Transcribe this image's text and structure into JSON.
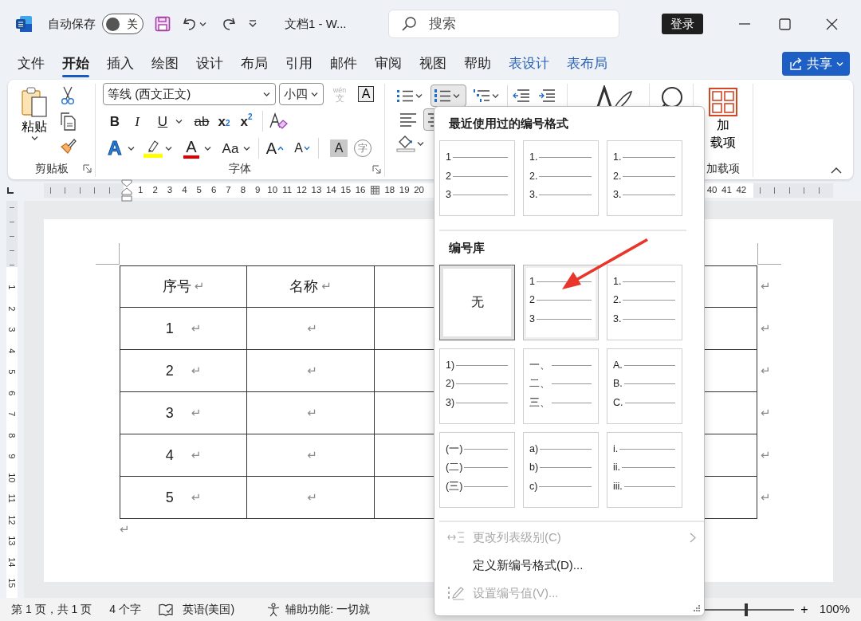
{
  "title_bar": {
    "autosave_label": "自动保存",
    "autosave": {
      "on": false,
      "label": "关"
    },
    "document_title": "文档1 - W...",
    "search": {
      "placeholder": "搜索"
    },
    "sign_in": "登录"
  },
  "tabs": [
    {
      "label": "文件",
      "selected": false,
      "kind": "normal"
    },
    {
      "label": "开始",
      "selected": true,
      "kind": "normal"
    },
    {
      "label": "插入",
      "selected": false,
      "kind": "normal"
    },
    {
      "label": "绘图",
      "selected": false,
      "kind": "normal"
    },
    {
      "label": "设计",
      "selected": false,
      "kind": "normal"
    },
    {
      "label": "布局",
      "selected": false,
      "kind": "normal"
    },
    {
      "label": "引用",
      "selected": false,
      "kind": "normal"
    },
    {
      "label": "邮件",
      "selected": false,
      "kind": "normal"
    },
    {
      "label": "审阅",
      "selected": false,
      "kind": "normal"
    },
    {
      "label": "视图",
      "selected": false,
      "kind": "normal"
    },
    {
      "label": "帮助",
      "selected": false,
      "kind": "normal"
    },
    {
      "label": "表设计",
      "selected": false,
      "kind": "contextual"
    },
    {
      "label": "表布局",
      "selected": false,
      "kind": "contextual"
    }
  ],
  "share_button": "共享",
  "ribbon": {
    "clipboard": {
      "paste": "粘贴",
      "label": "剪贴板"
    },
    "font": {
      "font_name": "等线 (西文正文)",
      "font_size": "小四",
      "phonetic": {
        "top": "wén",
        "bottom": "文",
        "disabled": true
      },
      "border_char": "A",
      "row2": [
        {
          "label": "B",
          "kind": "bold"
        },
        {
          "label": "I",
          "kind": "italic"
        },
        {
          "label": "U",
          "kind": "underline"
        },
        {
          "label": "ab",
          "kind": "strike"
        },
        {
          "label": "x$_{2}$",
          "kind": "subscript"
        },
        {
          "label": "x$^{2}$",
          "kind": "superscript"
        }
      ],
      "row3": [
        {
          "label": "A",
          "kind": "text_effect"
        },
        {
          "kind": "highlight"
        },
        {
          "label": "A",
          "kind": "font_color"
        },
        {
          "label": "Aa",
          "kind": "change_case"
        },
        {
          "label": "A",
          "kind": "grow"
        },
        {
          "label": "A",
          "kind": "shrink"
        },
        {
          "label": "A",
          "kind": "shade"
        },
        {
          "label": "字",
          "kind": "enclose"
        }
      ],
      "label": "字体"
    },
    "paragraph": {
      "numbering_expanded": true,
      "align": [
        {
          "kind": "left",
          "selected": false
        },
        {
          "kind": "center",
          "selected": true
        }
      ]
    },
    "add_ins": {
      "button_lines": [
        "加",
        "载项"
      ],
      "label": "加载项"
    }
  },
  "ruler": {
    "segments": [
      {
        "kind": "numbers",
        "numbers": [
          "1",
          "2",
          "3",
          "4",
          "5",
          "6",
          "7",
          "8",
          "9",
          "10",
          "11",
          "12",
          "13",
          "14",
          "15",
          "16"
        ]
      },
      {
        "kind": "marker"
      },
      {
        "kind": "numbers",
        "numbers": [
          "18",
          "19",
          "20"
        ]
      },
      {
        "kind": "spacer"
      },
      {
        "kind": "numbers",
        "numbers": [
          "40",
          "41",
          "42"
        ]
      }
    ]
  },
  "vertical_ruler": {
    "numbers": [
      "1",
      "2",
      "3",
      "4",
      "5",
      "6",
      "7",
      "8",
      "9",
      "10",
      "11",
      "12",
      "13",
      "14",
      "15"
    ]
  },
  "document": {
    "table": {
      "header": [
        {
          "text": "序号",
          "mark": "↵"
        },
        {
          "text": "名称",
          "mark": "↵"
        }
      ],
      "header_end_mark": "↵",
      "rows": [
        {
          "cells": [
            {
              "text": "1",
              "mark": "↵"
            },
            {
              "mark": "↵"
            }
          ],
          "end_mark": "↵"
        },
        {
          "cells": [
            {
              "text": "2",
              "mark": "↵"
            },
            {
              "mark": "↵"
            }
          ],
          "end_mark": "↵"
        },
        {
          "cells": [
            {
              "text": "3",
              "mark": "↵"
            },
            {
              "mark": "↵"
            }
          ],
          "end_mark": "↵"
        },
        {
          "cells": [
            {
              "text": "4",
              "mark": "↵"
            },
            {
              "mark": "↵"
            }
          ],
          "end_mark": "↵"
        },
        {
          "cells": [
            {
              "text": "5",
              "mark": "↵"
            },
            {
              "mark": "↵"
            }
          ],
          "end_mark": "↵"
        }
      ]
    },
    "end_mark": "↵"
  },
  "numbering_menu": {
    "recent_title": "最近使用过的编号格式",
    "recent": [
      {
        "kind": "list",
        "lines": [
          "1",
          "2",
          "3"
        ],
        "selected": false,
        "hovered": false
      },
      {
        "kind": "list",
        "lines": [
          "1.",
          "2.",
          "3."
        ],
        "selected": false,
        "hovered": false
      },
      {
        "kind": "list",
        "lines": [
          "1.",
          "2.",
          "3."
        ],
        "selected": false,
        "hovered": false
      }
    ],
    "library_title": "编号库",
    "library": [
      {
        "kind": "none",
        "label": "无",
        "selected": true,
        "hovered": false
      },
      {
        "kind": "list",
        "lines": [
          "1",
          "2",
          "3"
        ],
        "selected": false,
        "hovered": true
      },
      {
        "kind": "list",
        "lines": [
          "1.",
          "2.",
          "3."
        ],
        "selected": false,
        "hovered": false
      },
      {
        "kind": "list",
        "lines": [
          "1)",
          "2)",
          "3)"
        ],
        "selected": false,
        "hovered": false
      },
      {
        "kind": "list",
        "lines": [
          "一、",
          "二、",
          "三、"
        ],
        "selected": false,
        "hovered": false
      },
      {
        "kind": "list",
        "lines": [
          "A.",
          "B.",
          "C."
        ],
        "selected": false,
        "hovered": false
      },
      {
        "kind": "list",
        "lines": [
          "(一)",
          "(二)",
          "(三)"
        ],
        "selected": false,
        "hovered": false
      },
      {
        "kind": "list",
        "lines": [
          "a)",
          "b)",
          "c)"
        ],
        "selected": false,
        "hovered": false
      },
      {
        "kind": "list",
        "lines": [
          "i.",
          "ii.",
          "iii."
        ],
        "selected": false,
        "hovered": false
      }
    ],
    "items": [
      {
        "label": "更改列表级别(C)",
        "disabled": true,
        "kind": "level",
        "submenu": true
      },
      {
        "label": "定义新编号格式(D)...",
        "disabled": false,
        "kind": "plain",
        "submenu": false
      },
      {
        "label": "设置编号值(V)...",
        "disabled": true,
        "kind": "value",
        "submenu": false
      }
    ]
  },
  "status_bar": {
    "page": "第 1 页，共 1 页",
    "words": "4 个字",
    "language": "英语(美国)",
    "accessibility": "辅助功能: 一切就",
    "zoom": {
      "plus": "+",
      "level": 0.5,
      "reading": "100%"
    }
  }
}
